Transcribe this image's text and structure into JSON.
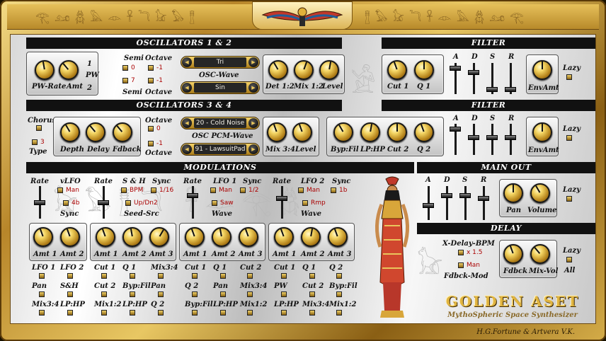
{
  "colors": {
    "gold": "#e2bc4c",
    "header_bg": "#111111",
    "value_red": "#aa0000",
    "display_bg": "#262626"
  },
  "icons": {
    "logo": "winged-goddess-icon",
    "figure": "goddess-figure-icon",
    "scribe": "seated-scribe-icon",
    "cat": "cat-statue-icon",
    "hieroglyph": "hieroglyph-border-icon"
  },
  "osc12": {
    "header": "OSCILLATORS 1 & 2",
    "knobs": {
      "pwrate": "PW-Rate",
      "amt": "Amt",
      "det": "Det 1:2",
      "mix": "Mix 1:2",
      "level": "Level"
    },
    "pw": {
      "label": "PW",
      "n1": "1",
      "n2": "2"
    },
    "semi": "Semi",
    "semi_bottom": "Semi",
    "octave": "Octave",
    "octave_bottom": "Octave",
    "semi1": "0",
    "semi2": "7",
    "oct1": "-1",
    "oct2": "-1",
    "wave_label": "OSC-Wave",
    "wave1": "Tri",
    "wave2": "Sin"
  },
  "filter1": {
    "header": "FILTER",
    "cut": "Cut 1",
    "q": "Q 1",
    "adsr": [
      "A",
      "D",
      "S",
      "R"
    ],
    "envamt": "EnvAmt",
    "lazy": "Lazy"
  },
  "osc34": {
    "header": "OSCILLATORS 3 & 4",
    "chorus": "Chorus",
    "type": "Type",
    "type_val": "3",
    "depth": "Depth",
    "delay": "Delay",
    "fdback": "Fdback",
    "octave1": "Octave",
    "octave2": "Octave",
    "oct3": "0",
    "oct4": "-1",
    "wave_label": "OSC PCM-Wave",
    "wave3": "20 - Cold Noise",
    "wave4": "91 - LawsuitPad",
    "mix": "Mix 3:4",
    "level": "Level"
  },
  "filter2": {
    "header": "FILTER",
    "bypfil": "Byp:Fil",
    "lphp": "LP:HP",
    "cut": "Cut 2",
    "q": "Q 2",
    "adsr": [
      "A",
      "D",
      "S",
      "R"
    ],
    "envamt": "EnvAmt",
    "lazy": "Lazy"
  },
  "mod": {
    "header": "MODULATIONS",
    "vlfo": {
      "rate": "Rate",
      "title": "vLFO",
      "val": "Man",
      "sync": "Sync",
      "sync_val": "4b"
    },
    "sh": {
      "rate": "Rate",
      "title": "S & H",
      "val1": "BPM",
      "sync": "Sync",
      "sync_val": "1/16",
      "val2": "Up/Dn2",
      "seed": "Seed-Src"
    },
    "lfo1": {
      "rate": "Rate",
      "title": "LFO 1",
      "val": "Man",
      "sync": "Sync",
      "sync_val": "1/2",
      "wave_val": "Saw",
      "wave": "Wave"
    },
    "lfo2": {
      "rate": "Rate",
      "title": "LFO 2",
      "val": "Man",
      "sync": "Sync",
      "sync_val": "1b",
      "wave_val": "Rmp",
      "wave": "Wave"
    },
    "amt": {
      "a1": "Amt 1",
      "a2": "Amt 2",
      "a3": "Amt 3"
    },
    "dest_rows": [
      [
        "LFO 1",
        "LFO 2",
        "Cut 1",
        "Q 1",
        "Mix3:4",
        "Cut 1",
        "Q 1",
        "Cut 2",
        "Cut 1",
        "Q 1",
        "Q 2"
      ],
      [
        "Pan",
        "S&H",
        "Cut 2",
        "Byp:Fil",
        "Pan",
        "Q 2",
        "Pan",
        "Mix3:4",
        "PW",
        "Cut 2",
        "Byp:Fil"
      ],
      [
        "Mix3:4",
        "LP:HP",
        "Mix1:2",
        "LP:HP",
        "Q 2",
        "Byp:Fil",
        "LP:HP",
        "Mix1:2",
        "LP:HP",
        "Mix3:4",
        "Mix1:2"
      ]
    ]
  },
  "mainout": {
    "header": "MAIN OUT",
    "adsr": [
      "A",
      "D",
      "S",
      "R"
    ],
    "pan": "Pan",
    "volume": "Volume",
    "lazy": "Lazy"
  },
  "delay": {
    "header": "DELAY",
    "bpm": "X-Delay-BPM",
    "bpm_val": "x 1.5",
    "mod_val": "Man",
    "mod": "Fdbck-Mod",
    "fdbck": "Fdbck",
    "mixvol": "Mix-Vol",
    "lazy": "Lazy",
    "all": "All"
  },
  "brand": {
    "name": "GOLDEN ASET",
    "tagline": "MythoSpheric Space Synthesizer",
    "credit": "H.G.Fortune & Artvera V.K."
  }
}
